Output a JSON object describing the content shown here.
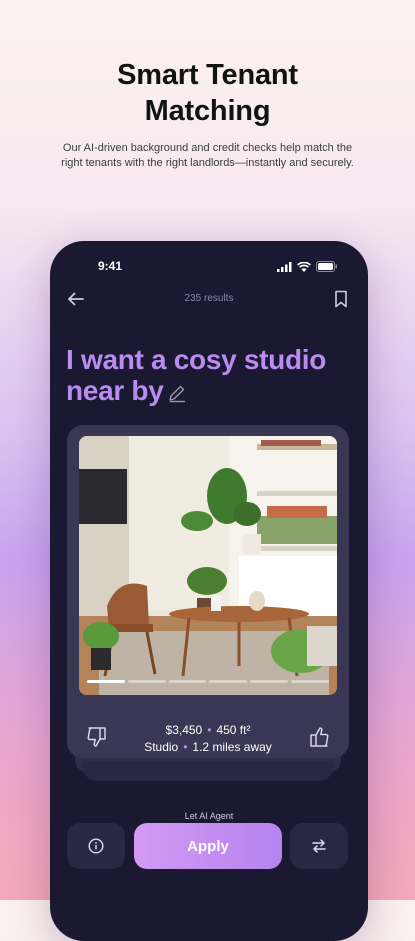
{
  "hero": {
    "title_line1": "Smart Tenant",
    "title_line2": "Matching",
    "subtitle_line1": "Our AI-driven background and credit checks help match the",
    "subtitle_line2": "right tenants with the right landlords—instantly and securely."
  },
  "status_bar": {
    "time": "9:41",
    "icons": [
      "signal-icon",
      "wifi-icon",
      "battery-icon"
    ]
  },
  "nav": {
    "results": "235 results",
    "back_icon": "arrow-left-icon",
    "bookmark_icon": "bookmark-icon"
  },
  "prompt": {
    "line1": "I want a cosy studio",
    "line2": "near by",
    "edit_icon": "pencil-icon"
  },
  "listing": {
    "price": "$3,450",
    "area": "450 ft²",
    "type": "Studio",
    "distance": "1.2 miles away",
    "separator": "•",
    "photo_count": 6,
    "active_photo": 1
  },
  "actions": {
    "agent_label": "Let AI Agent",
    "apply_label": "Apply",
    "info_icon": "info-icon",
    "swap_icon": "swap-icon",
    "dislike_icon": "thumbs-down-icon",
    "like_icon": "thumbs-up-icon"
  },
  "colors": {
    "accent": "#b98cf0",
    "phone_bg": "#1b1932",
    "card_bg": "#3a3755"
  }
}
